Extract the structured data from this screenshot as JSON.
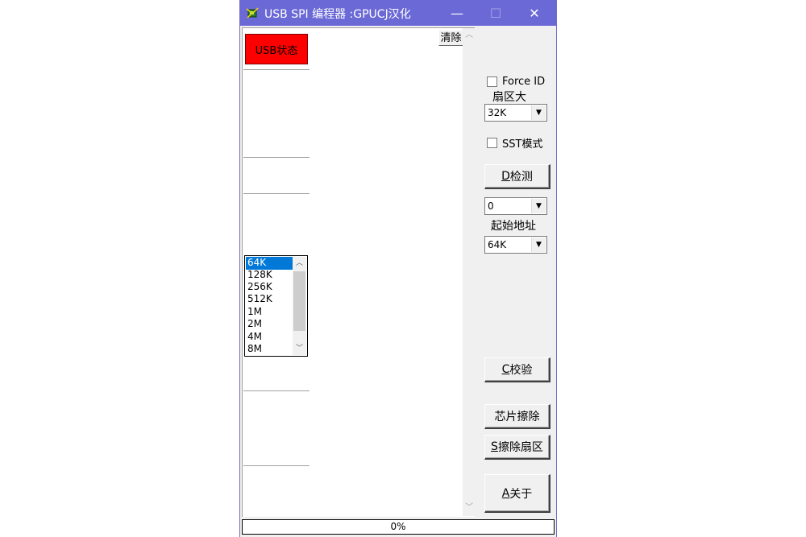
{
  "window": {
    "title": "USB SPI 编程器 :GPUCJ汉化"
  },
  "titlebar": {
    "min": "—",
    "max": "☐",
    "close": "✕"
  },
  "log": {
    "clear_label": "清除"
  },
  "panel": {
    "usb_status": "USB状态",
    "force_id": "Force ID",
    "sector_size_label": "扇区大",
    "sector_size_value": "32K",
    "sst_mode": "SST模式",
    "detect_hotkey": "D",
    "detect_label": "检测",
    "start_addr_value": "0",
    "start_addr_label": "起始地址",
    "size_value": "64K",
    "size_options": [
      "64K",
      "128K",
      "256K",
      "512K",
      "1M",
      "2M",
      "4M",
      "8M"
    ],
    "verify_hotkey": "C",
    "verify_label": "校验",
    "chip_erase_label": "芯片擦除",
    "sector_erase_hotkey": "S",
    "sector_erase_label": "擦除扇区",
    "about_hotkey": "A",
    "about_label": "关于"
  },
  "progress": {
    "text": "0%"
  }
}
